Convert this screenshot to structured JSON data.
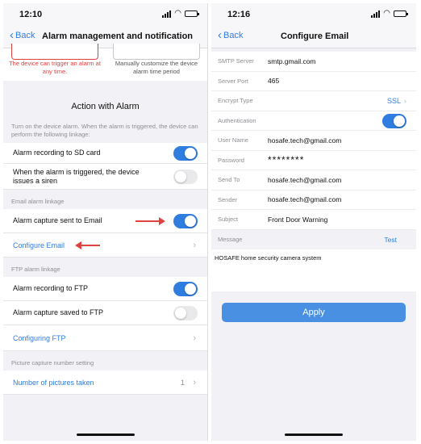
{
  "left": {
    "status_time": "12:10",
    "back_label": "Back",
    "title": "Alarm management and notification",
    "mode_triggered_text": "The device can trigger an alarm at any time.",
    "mode_manual_text": "Manually customize the device alarm time period",
    "action_title": "Action with Alarm",
    "action_desc": "Turn on the device alarm. When the alarm is triggered, the device can perform the following linkage:",
    "rows_alarm": [
      {
        "label": "Alarm recording to SD card",
        "toggle": "on"
      },
      {
        "label": "When the alarm is triggered, the device issues a siren",
        "toggle": "off"
      }
    ],
    "email_header": "Email alarm linkage",
    "email_capture_label": "Alarm capture sent to Email",
    "email_capture_toggle": "on",
    "configure_email_label": "Configure Email",
    "ftp_header": "FTP alarm linkage",
    "ftp_recording_label": "Alarm recording to FTP",
    "ftp_recording_toggle": "on",
    "ftp_capture_label": "Alarm capture saved to FTP",
    "ftp_capture_toggle": "off",
    "configuring_ftp_label": "Configuring FTP",
    "picture_header": "Picture capture number setting",
    "pictures_label": "Number of pictures taken",
    "pictures_value": "1"
  },
  "right": {
    "status_time": "12:16",
    "back_label": "Back",
    "title": "Configure Email",
    "fields": {
      "smtp_server_label": "SMTP Server",
      "smtp_server_value": "smtp.gmail.com",
      "server_port_label": "Server Port",
      "server_port_value": "465",
      "encrypt_type_label": "Encrypt Type",
      "encrypt_type_value": "SSL",
      "authentication_label": "Authentication",
      "authentication_toggle": "on",
      "user_name_label": "User Name",
      "user_name_value": "hosafe.tech@gmail.com",
      "password_label": "Password",
      "password_value": "********",
      "send_to_label": "Send To",
      "send_to_value": "hosafe.tech@gmail.com",
      "sender_label": "Sender",
      "sender_value": "hosafe.tech@gmail.com",
      "subject_label": "Subject",
      "subject_value": "Front Door Warning"
    },
    "message_label": "Message",
    "test_label": "Test",
    "message_value": "HOSAFE home security camera system",
    "apply_label": "Apply"
  },
  "colors": {
    "accent": "#2f7de1",
    "apply_button": "#4a90e2",
    "warning_red": "#e0423f",
    "background": "#f2f2f6"
  }
}
